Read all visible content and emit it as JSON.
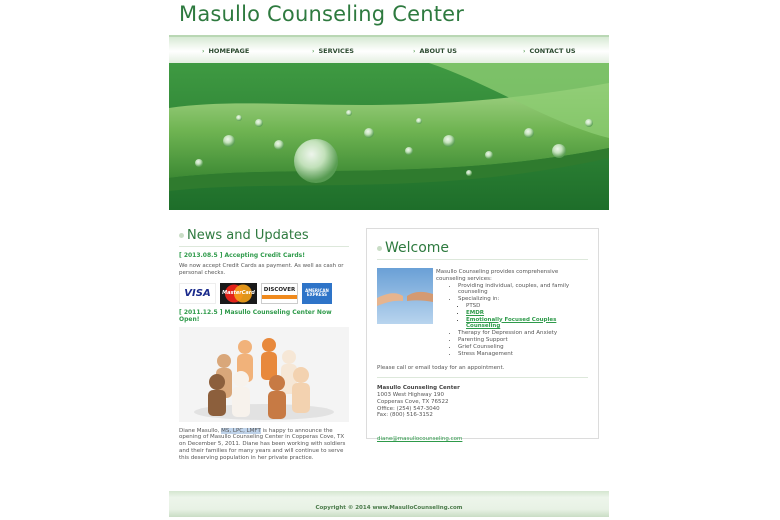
{
  "site": {
    "title": "Masullo Counseling Center"
  },
  "nav": {
    "items": [
      {
        "label": "HOMEPAGE"
      },
      {
        "label": "SERVICES"
      },
      {
        "label": "ABOUT US"
      },
      {
        "label": "CONTACT US"
      }
    ]
  },
  "news": {
    "heading": "News and Updates",
    "item1_title": "[ 2013.08.5 ] Accepting Credit Cards!",
    "item1_text": "We now accept Credit Cards as payment. As well as cash or personal checks.",
    "cards": {
      "visa": "VISA",
      "mastercard": "MasterCard",
      "discover": "DISCOVER",
      "amex": "AMERICAN EXPRESS"
    },
    "item2_title": "[ 2011.12.5 ] Masullo Counseling Center Now Open!",
    "item2_text_a": "Diane Masullo, ",
    "item2_text_hl": "MS, LPC, LMFT",
    "item2_text_b": " is happy to announce the opening of Masullo Counseling Center in Copperas Cove, TX on December 5, 2011. Diane has been working with soldiers and their families for many years and will continue to serve this deserving population in her private practice."
  },
  "welcome": {
    "heading": "Welcome",
    "intro": "Masullo Counseling provides comprehensive counseling services:",
    "services": [
      "Providing individual, couples, and family counseling",
      "Specializing in:"
    ],
    "specialties": [
      {
        "label": "PTSD",
        "link": false
      },
      {
        "label": "EMDR",
        "link": true
      },
      {
        "label": "Emotionally Focused Couples Counseling",
        "link": true
      }
    ],
    "more_services": [
      "Therapy for Depression and Anxiety",
      "Parenting Support",
      "Grief Counseling",
      "Stress Management"
    ],
    "call_text": "Please call or email today for an appointment.",
    "address": {
      "name": "Masullo Counseling Center",
      "street": "1003 West Highway 190",
      "city": "Copperas Cove, TX 76522",
      "office": "Office: (254) 547-3040",
      "fax": "Fax: (800) 516-3152"
    },
    "email": "diane@masullocounseling.com"
  },
  "footer": {
    "copyright": "Copyright © 2014 www.MasulloCounseling.com"
  },
  "colors": {
    "brand_green": "#2e7a3f",
    "link_green": "#2e9a4a"
  }
}
